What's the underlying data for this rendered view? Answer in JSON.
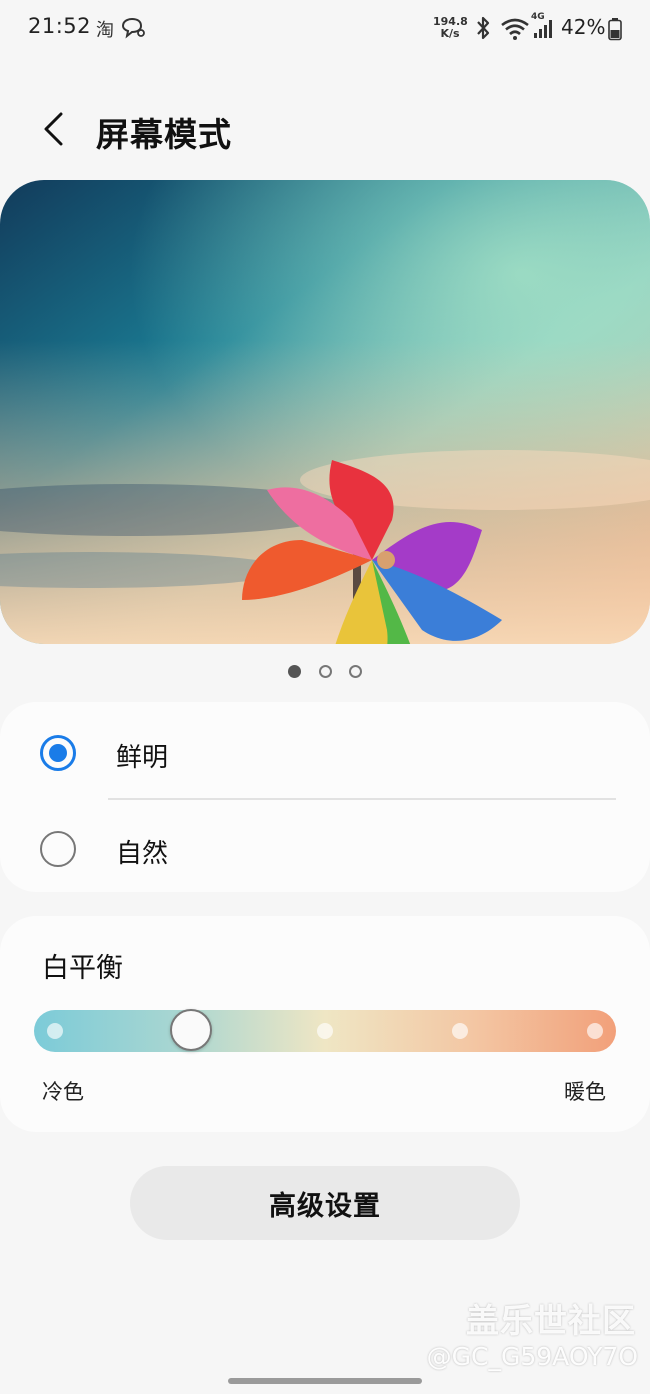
{
  "status_bar": {
    "time": "21:52",
    "app_icon_1": "淘",
    "net_speed_value": "194.8",
    "net_speed_unit": "K/s",
    "network_type": "4G",
    "battery_percent": "42%",
    "icons": [
      "taobao-icon",
      "chat-icon",
      "bluetooth-icon",
      "wifi-icon",
      "signal-icon",
      "battery-icon"
    ]
  },
  "header": {
    "back_icon": "chevron-left-icon",
    "title": "屏幕模式"
  },
  "preview": {
    "image": "pinwheel-photo",
    "pages": 3,
    "active_page": 1
  },
  "modes": [
    {
      "label": "鲜明",
      "selected": true
    },
    {
      "label": "自然",
      "selected": false
    }
  ],
  "white_balance": {
    "title": "白平衡",
    "cold_label": "冷色",
    "warm_label": "暖色",
    "steps": 5,
    "value_step": 2
  },
  "advanced_button": "高级设置",
  "watermark": {
    "site": "盖乐世社区",
    "user": "@GC_G59AOY7O"
  },
  "colors": {
    "accent": "#1a7ce8",
    "background": "#f6f6f6",
    "card": "#fcfcfc"
  }
}
